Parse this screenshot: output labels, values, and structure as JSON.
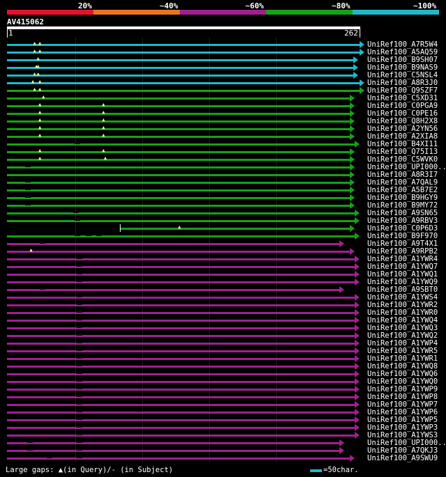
{
  "header": {
    "percent_labels": [
      "20%",
      "~40%",
      "~60%",
      "~80%",
      "~100%"
    ],
    "colors": [
      "#e8102e",
      "#e87422",
      "#a0208e",
      "#18a018",
      "#20b8c8"
    ]
  },
  "query": {
    "name": "AV415062",
    "start": "1",
    "end": "262"
  },
  "hits": [
    {
      "id": "UniRef100_A7R5W4",
      "c": "#20b8c8",
      "end": 0.999,
      "gq": [
        0.08,
        0.095
      ]
    },
    {
      "id": "UniRef100_A5AQ59",
      "c": "#20b8c8",
      "end": 0.999,
      "gq": [
        0.08,
        0.095
      ]
    },
    {
      "id": "UniRef100_B9SH07",
      "c": "#20b8c8",
      "end": 0.98,
      "gq": [
        0.09
      ]
    },
    {
      "id": "UniRef100_B9NAS9",
      "c": "#20b8c8",
      "end": 0.98,
      "gq": [
        0.085,
        0.09
      ]
    },
    {
      "id": "UniRef100_C5NSL4",
      "c": "#20b8c8",
      "end": 0.98,
      "gq": [
        0.08,
        0.09
      ]
    },
    {
      "id": "UniRef100_A8R3J0",
      "c": "#20b8c8",
      "end": 0.999,
      "gq": [
        0.075,
        0.095
      ]
    },
    {
      "id": "UniRef100_Q9SZF7",
      "c": "#18a018",
      "end": 0.999,
      "gq": [
        0.08,
        0.095
      ]
    },
    {
      "id": "UniRef100_C5XD31",
      "c": "#18a018",
      "end": 0.97,
      "gq": [
        0.105
      ]
    },
    {
      "id": "UniRef100_C0PGA9",
      "c": "#18a018",
      "end": 0.97,
      "gq": [
        0.095,
        0.275
      ]
    },
    {
      "id": "UniRef100_C0PE16",
      "c": "#18a018",
      "end": 0.97,
      "gq": [
        0.095,
        0.275
      ]
    },
    {
      "id": "UniRef100_Q8H2X8",
      "c": "#18a018",
      "end": 0.97,
      "gq": [
        0.095,
        0.275
      ]
    },
    {
      "id": "UniRef100_A2YN56",
      "c": "#18a018",
      "end": 0.97,
      "gq": [
        0.095,
        0.275
      ]
    },
    {
      "id": "UniRef100_A2XIA8",
      "c": "#18a018",
      "end": 0.97,
      "gq": [
        0.095,
        0.275
      ]
    },
    {
      "id": "UniRef100_B4XI11",
      "c": "#18a018",
      "end": 0.984,
      "gs": [
        0.2
      ]
    },
    {
      "id": "UniRef100_Q75I13",
      "c": "#18a018",
      "end": 0.97,
      "gq": [
        0.095,
        0.275
      ]
    },
    {
      "id": "UniRef100_C5WVK0",
      "c": "#18a018",
      "end": 0.97,
      "gq": [
        0.095,
        0.28
      ]
    },
    {
      "id": "UniRef100_UPI000..",
      "c": "#18a018",
      "end": 0.97,
      "gs": [
        0.06
      ]
    },
    {
      "id": "UniRef100_A8R3I7",
      "c": "#18a018",
      "end": 0.97
    },
    {
      "id": "UniRef100_A7QAL9",
      "c": "#18a018",
      "end": 0.97,
      "gs": [
        0.06
      ]
    },
    {
      "id": "UniRef100_A5B7E2",
      "c": "#18a018",
      "end": 0.97,
      "gs": [
        0.06
      ]
    },
    {
      "id": "UniRef100_B9HGY9",
      "c": "#18a018",
      "end": 0.97,
      "gs": [
        0.06
      ]
    },
    {
      "id": "UniRef100_B9MY72",
      "c": "#18a018",
      "end": 0.97,
      "gs": [
        0.06
      ]
    },
    {
      "id": "UniRef100_A9SN65",
      "c": "#18a018",
      "end": 0.984,
      "gs": [
        0.195
      ]
    },
    {
      "id": "UniRef100_A9RBV3",
      "c": "#18a018",
      "end": 0.984,
      "gs": [
        0.2
      ]
    },
    {
      "id": "UniRef100_C0P6D3",
      "c": "#18a018",
      "end": 0.97,
      "start": 0.32,
      "gq": [
        0.49
      ]
    },
    {
      "id": "UniRef100_B9F970",
      "c": "#18a018",
      "end": 0.984,
      "gs": [
        0.2,
        0.23,
        0.26
      ]
    },
    {
      "id": "UniRef100_A9T4X1",
      "c": "#a0208e",
      "end": 0.94,
      "gs": [
        0.1
      ]
    },
    {
      "id": "UniRef100_A9RPB2",
      "c": "#a0208e",
      "end": 0.97,
      "gq": [
        0.07
      ]
    },
    {
      "id": "UniRef100_A1YWR4",
      "c": "#a0208e",
      "end": 0.984,
      "gs": [
        0.205
      ]
    },
    {
      "id": "UniRef100_A1YWQ7",
      "c": "#a0208e",
      "end": 0.984,
      "gs": [
        0.205
      ]
    },
    {
      "id": "UniRef100_A1YWQ1",
      "c": "#a0208e",
      "end": 0.984,
      "gs": [
        0.205
      ]
    },
    {
      "id": "UniRef100_A1YWQ9",
      "c": "#a0208e",
      "end": 0.984,
      "gs": [
        0.205
      ]
    },
    {
      "id": "UniRef100_A9SBT0",
      "c": "#a0208e",
      "end": 0.94,
      "gs": [
        0.1
      ]
    },
    {
      "id": "UniRef100_A1YWS4",
      "c": "#a0208e",
      "end": 0.984,
      "gs": [
        0.205
      ]
    },
    {
      "id": "UniRef100_A1YWR2",
      "c": "#a0208e",
      "end": 0.984,
      "gs": [
        0.205
      ]
    },
    {
      "id": "UniRef100_A1YWR0",
      "c": "#a0208e",
      "end": 0.984,
      "gs": [
        0.205
      ]
    },
    {
      "id": "UniRef100_A1YWQ4",
      "c": "#a0208e",
      "end": 0.984,
      "gs": [
        0.205
      ]
    },
    {
      "id": "UniRef100_A1YWQ3",
      "c": "#a0208e",
      "end": 0.984,
      "gs": [
        0.205
      ]
    },
    {
      "id": "UniRef100_A1YWQ2",
      "c": "#a0208e",
      "end": 0.984,
      "gs": [
        0.205
      ]
    },
    {
      "id": "UniRef100_A1YWP4",
      "c": "#a0208e",
      "end": 0.984,
      "gs": [
        0.205
      ]
    },
    {
      "id": "UniRef100_A1YWR5",
      "c": "#a0208e",
      "end": 0.984,
      "gs": [
        0.205
      ]
    },
    {
      "id": "UniRef100_A1YWR1",
      "c": "#a0208e",
      "end": 0.984,
      "gs": [
        0.205
      ]
    },
    {
      "id": "UniRef100_A1YWQ8",
      "c": "#a0208e",
      "end": 0.984,
      "gs": [
        0.205
      ]
    },
    {
      "id": "UniRef100_A1YWQ6",
      "c": "#a0208e",
      "end": 0.984,
      "gs": [
        0.205
      ]
    },
    {
      "id": "UniRef100_A1YWQ0",
      "c": "#a0208e",
      "end": 0.984,
      "gs": [
        0.205
      ]
    },
    {
      "id": "UniRef100_A1YWP9",
      "c": "#a0208e",
      "end": 0.984,
      "gs": [
        0.205
      ]
    },
    {
      "id": "UniRef100_A1YWP8",
      "c": "#a0208e",
      "end": 0.984,
      "gs": [
        0.205
      ]
    },
    {
      "id": "UniRef100_A1YWP7",
      "c": "#a0208e",
      "end": 0.984,
      "gs": [
        0.205
      ]
    },
    {
      "id": "UniRef100_A1YWP6",
      "c": "#a0208e",
      "end": 0.984,
      "gs": [
        0.205
      ]
    },
    {
      "id": "UniRef100_A1YWP5",
      "c": "#a0208e",
      "end": 0.984,
      "gs": [
        0.205
      ]
    },
    {
      "id": "UniRef100_A1YWP3",
      "c": "#a0208e",
      "end": 0.984,
      "gs": [
        0.205
      ]
    },
    {
      "id": "UniRef100_A1YWS3",
      "c": "#a0208e",
      "end": 0.984,
      "gs": [
        0.205
      ]
    },
    {
      "id": "UniRef100_UPI000..",
      "c": "#a0208e",
      "end": 0.94,
      "gs": [
        0.065,
        0.205
      ]
    },
    {
      "id": "UniRef100_A7QKJ3",
      "c": "#a0208e",
      "end": 0.94,
      "gs": [
        0.065,
        0.205
      ]
    },
    {
      "id": "UniRef100_A9SWU9",
      "c": "#a0208e",
      "end": 0.97,
      "gs": [
        0.12,
        0.205
      ]
    }
  ],
  "legend": {
    "text": "Large gaps: ▲(in Query)/- (in Subject)",
    "scale": "=50char."
  }
}
